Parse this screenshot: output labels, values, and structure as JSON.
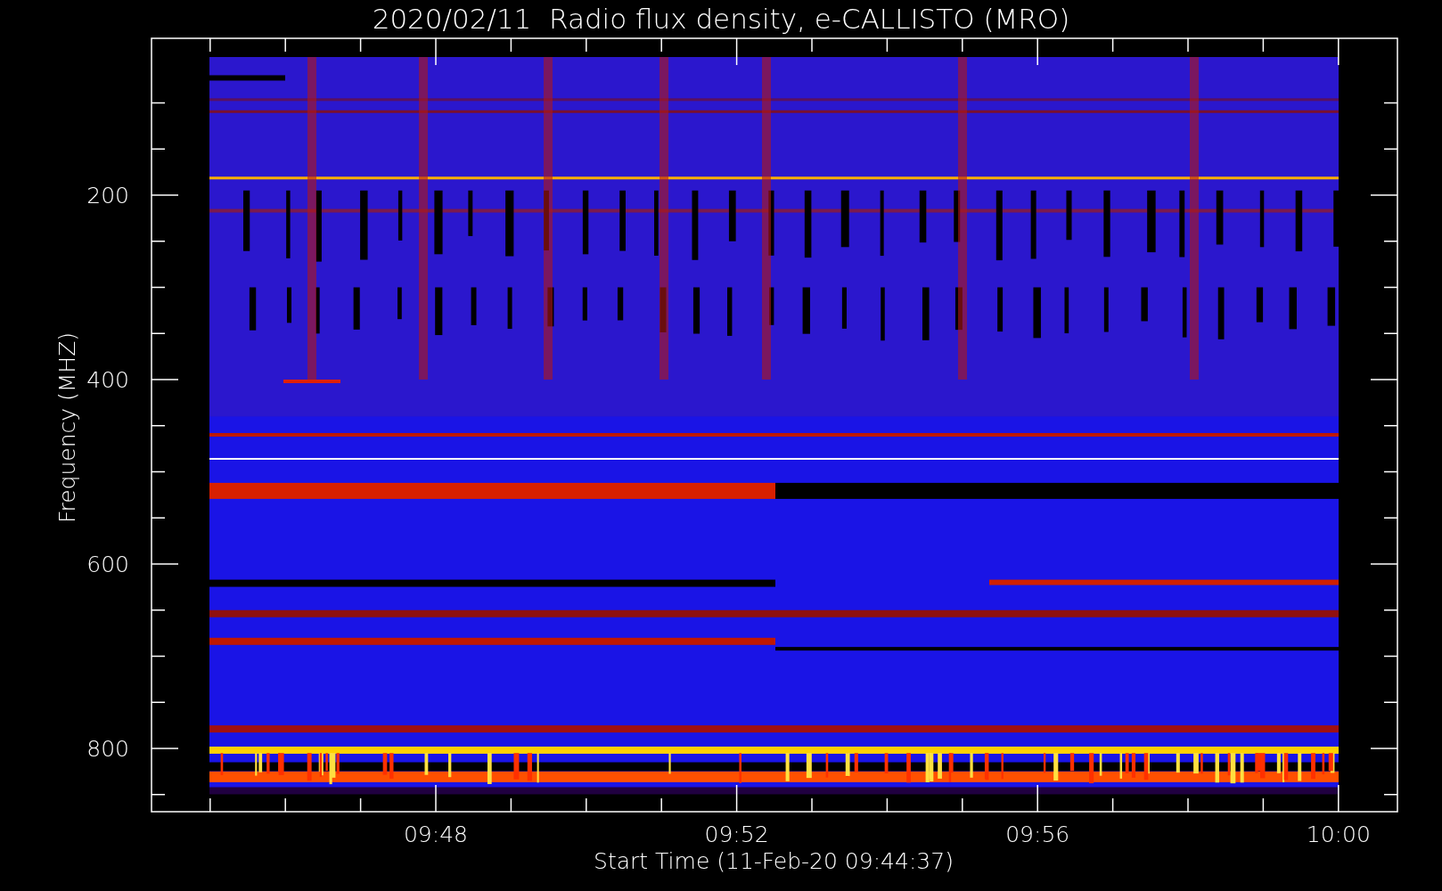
{
  "title": "2020/02/11  Radio flux density, e-CALLISTO (MRO)",
  "ylabel": "Frequency (MHZ)",
  "xlabel": "Start Time (11-Feb-20 09:44:37)",
  "yticks": [
    "200",
    "400",
    "600",
    "800"
  ],
  "xticks": [
    "09:48",
    "09:52",
    "09:56",
    "10:00"
  ]
}
